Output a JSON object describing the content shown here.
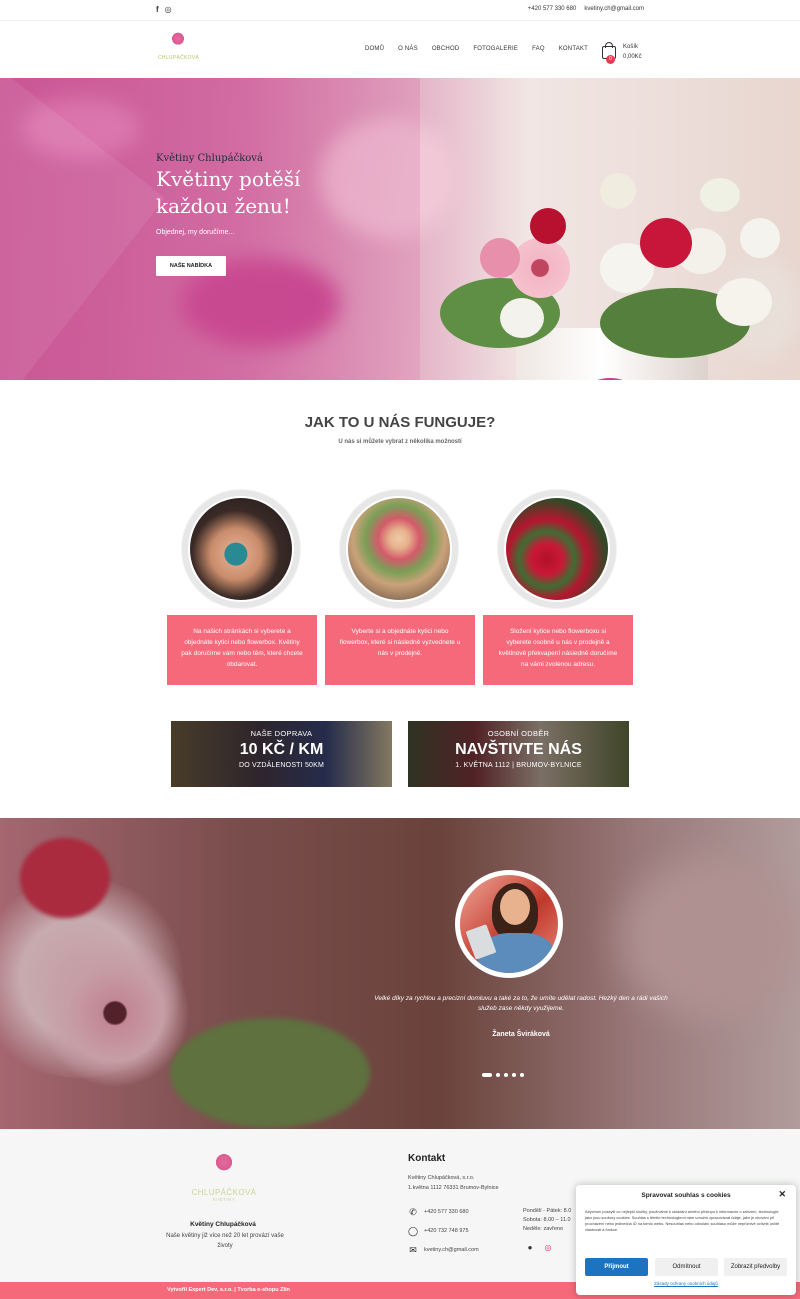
{
  "topbar": {
    "facebook_icon": "f",
    "instagram_icon": "◎",
    "phone": "+420 577 330 680",
    "email": "kvetiny.ch@gmail.com"
  },
  "header": {
    "logo_text": "CHLUPÁČKOVÁ",
    "nav": [
      "DOMŮ",
      "O NÁS",
      "OBCHOD",
      "FOTOGALERIE",
      "FAQ",
      "KONTAKT"
    ],
    "cart_label": "Košík",
    "cart_total": "0,00Kč",
    "cart_count": "0"
  },
  "hero": {
    "subtitle": "Květiny Chlupáčková",
    "title": "Květiny potěší každou ženu!",
    "text": "Objednej, my doručíme...",
    "button": "NAŠE NABÍDKA"
  },
  "how": {
    "title": "JAK TO U NÁS FUNGUJE?",
    "subtitle": "U nás si můžete vybrat z několika možností",
    "cards": [
      "Na našich stránkách si vyberete a objednáte kytici nebo flowerbox. Květiny pak doručíme vám nebo těm, které chcete obdarovat.",
      "Vyberte si a objednáte kytici nebo flowerbox, které si následně vyzvednete u nás v prodejně.",
      "Složení kytice nebo flowerboxu si vyberete osobně u nás v prodejně a květinové překvapení následně doručíme na vámi zvolenou adresu."
    ]
  },
  "banners": [
    {
      "line1": "NAŠE DOPRAVA",
      "line2": "10 KČ / KM",
      "line3": "DO VZDÁLENOSTI 50KM"
    },
    {
      "line1": "OSOBNÍ ODBĚR",
      "line2": "NAVŠTIVTE NÁS",
      "line3": "1. KVĚTNA 1112 | BRUMOV-BYLNICE"
    }
  ],
  "testimonial": {
    "quote": "Velké díky za rychlou a precizní domluvu a také za to, že umíte udělat radost. Hezký den a rádi vašich služeb zase někdy využijeme.",
    "author": "Žaneta Šviráková",
    "slides": 5,
    "active_slide": 1
  },
  "footer": {
    "logo_text": "CHLUPÁČKOVÁ",
    "logo_sub": "KVĚTINY",
    "name": "Květiny Chlupáčková",
    "desc": "Naše květiny již více než 20 let provází vaše životy",
    "kontakt_title": "Kontakt",
    "company_line1": "Květiny Chlupáčková, s.r.o.",
    "company_line2": "1.května 1112 76331 Brumov-Bylnice",
    "phone1": "+420 577 330 680",
    "phone2": "+420 732 748 975",
    "email": "kvetiny.ch@gmail.com",
    "hours": [
      "Pondělí - Pátek: 8.0",
      "Sobota: 8.00 – 11.0",
      "Neděle: zavřeno"
    ],
    "credit": "Vytvořil Expert Dev, s.r.o. | Tvorba e-shopu Zlín"
  },
  "cookie": {
    "title": "Spravovat souhlas s cookies",
    "text": "Abychom poskytli co nejlepší služby, používáme k ukládání a/nebo přístupu k informacím o zařízení, technologie jako jsou soubory cookies. Souhlas s těmito technologiemi nám umožní zpracovávat údaje, jako je chování při procházení nebo jedinečná ID na tomto webu. Nesouhlas nebo odvolání souhlasu může nepříznivě ovlivnit určité vlastnosti a funkce.",
    "accept": "Přijmout",
    "deny": "Odmítnout",
    "prefs": "Zobrazit předvolby",
    "link": "Zásady ochrany osobních údajů"
  },
  "colors": {
    "accent": "#f6697a",
    "cookie_button": "#1e73be"
  }
}
